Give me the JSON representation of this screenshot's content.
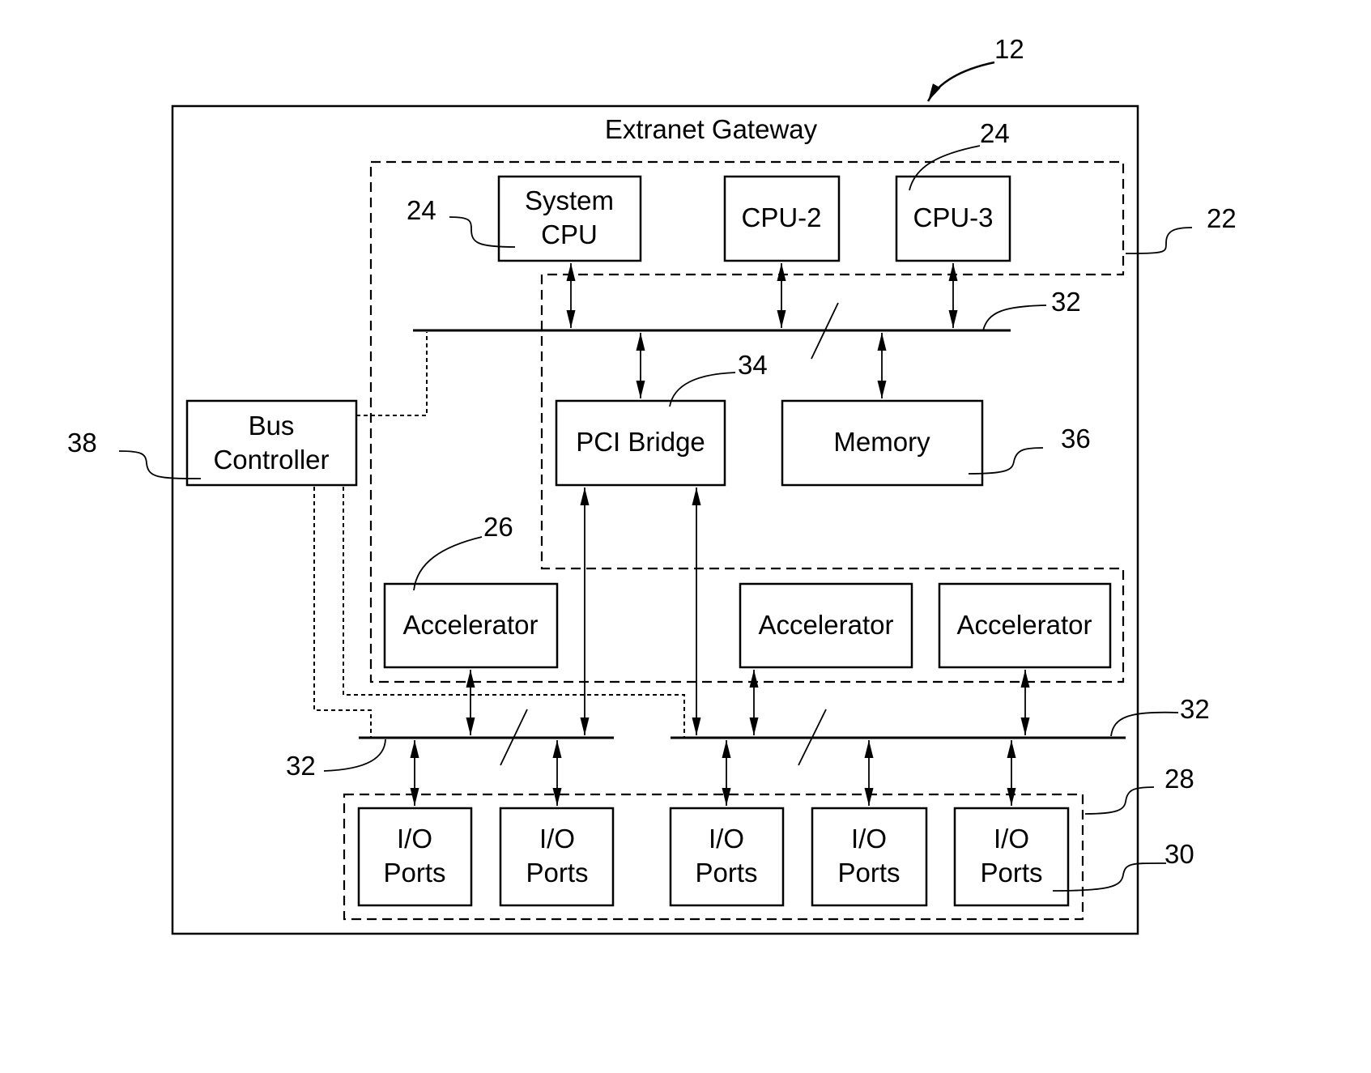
{
  "diagram": {
    "title": "Extranet Gateway",
    "components": {
      "system_cpu": {
        "line1": "System",
        "line2": "CPU"
      },
      "cpu2": "CPU-2",
      "cpu3": "CPU-3",
      "bus_controller": {
        "line1": "Bus",
        "line2": "Controller"
      },
      "pci_bridge": "PCI Bridge",
      "memory": "Memory",
      "accelerators": [
        "Accelerator",
        "Accelerator",
        "Accelerator"
      ],
      "io_ports": [
        {
          "line1": "I/O",
          "line2": "Ports"
        },
        {
          "line1": "I/O",
          "line2": "Ports"
        },
        {
          "line1": "I/O",
          "line2": "Ports"
        },
        {
          "line1": "I/O",
          "line2": "Ports"
        },
        {
          "line1": "I/O",
          "line2": "Ports"
        }
      ]
    },
    "reference_numerals": {
      "gateway": "12",
      "cpu_group": "22",
      "system_cpu": "24",
      "cpu3": "24",
      "accelerator": "26",
      "io_group": "28",
      "io_port": "30",
      "bus_top": "32",
      "bus_bottom_left": "32",
      "bus_bottom_right": "32",
      "pci_bridge": "34",
      "memory": "36",
      "bus_controller": "38"
    }
  }
}
